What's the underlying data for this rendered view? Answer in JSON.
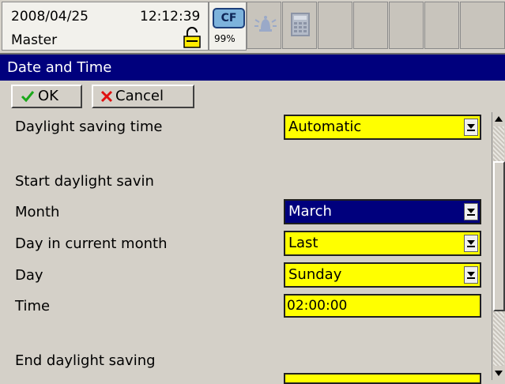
{
  "status_bar": {
    "date": "2008/04/25",
    "time": "12:12:39",
    "user": "Master",
    "cf_label": "CF",
    "cf_usage": "99%"
  },
  "title": "Date and Time",
  "toolbar": {
    "ok_label": "OK",
    "cancel_label": "Cancel"
  },
  "settings": {
    "daylight_label": "Daylight saving time",
    "daylight_value": "Automatic",
    "start_heading": "Start daylight savin",
    "month_label": "Month",
    "month_value": "March",
    "day_in_month_label": "Day in current month",
    "day_in_month_value": "Last",
    "day_label": "Day",
    "day_value": "Sunday",
    "time_label": "Time",
    "time_value": "02:00:00",
    "end_heading": "End daylight saving"
  },
  "colors": {
    "title_bar": "#00007d",
    "field_yellow": "#ffff00",
    "panel_gray": "#d4d0c8"
  }
}
